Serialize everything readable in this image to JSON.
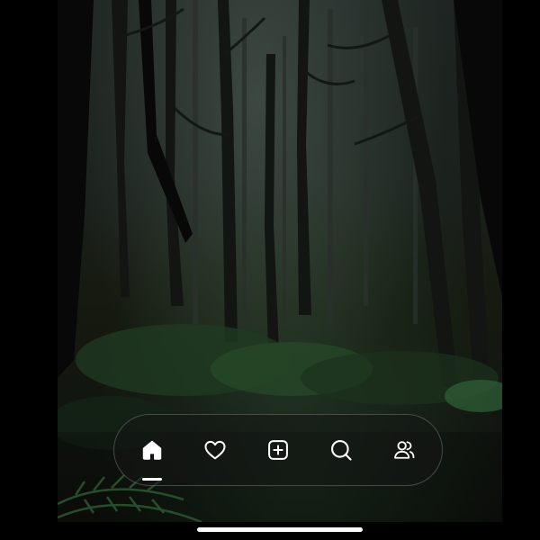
{
  "background": {
    "description_icon": "forest-photo",
    "canvas_color": "#000000"
  },
  "navbar": {
    "items": [
      {
        "icon": "home-icon",
        "active": true
      },
      {
        "icon": "heart-icon",
        "active": false
      },
      {
        "icon": "add-square-icon",
        "active": false
      },
      {
        "icon": "search-icon",
        "active": false
      },
      {
        "icon": "people-icon",
        "active": false
      }
    ],
    "icon_color": "#ffffff"
  }
}
